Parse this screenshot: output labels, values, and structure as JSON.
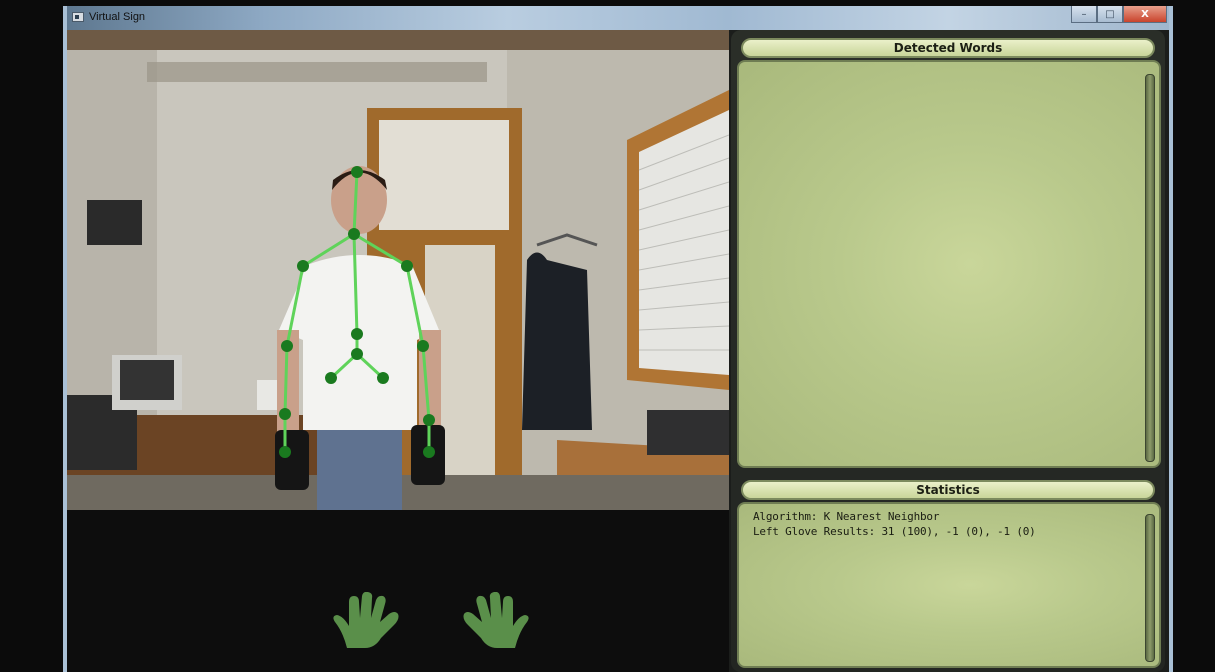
{
  "window": {
    "title": "Virtual Sign",
    "controls": {
      "minimize": "–",
      "maximize": "□",
      "close": "X"
    }
  },
  "camera_view": {
    "description_icon": "kinect-skeleton-overlay",
    "skeleton_color": "#5fd35a",
    "joint_color": "#1a7a1f"
  },
  "gesture_panel": {
    "hands": [
      {
        "icon": "left-hand-icon",
        "color": "#5a8f4a"
      },
      {
        "icon": "right-hand-icon",
        "color": "#5a8f4a"
      }
    ]
  },
  "detected_words": {
    "header": "Detected Words",
    "items": []
  },
  "statistics": {
    "header": "Statistics",
    "lines": [
      "Algorithm: K Nearest Neighbor",
      "Left Glove Results: 31 (100), -1 (0), -1 (0)"
    ]
  },
  "colors": {
    "panel_bg": "#c3d193",
    "header_bg": "#e0e8bb",
    "frame": "#232622"
  }
}
